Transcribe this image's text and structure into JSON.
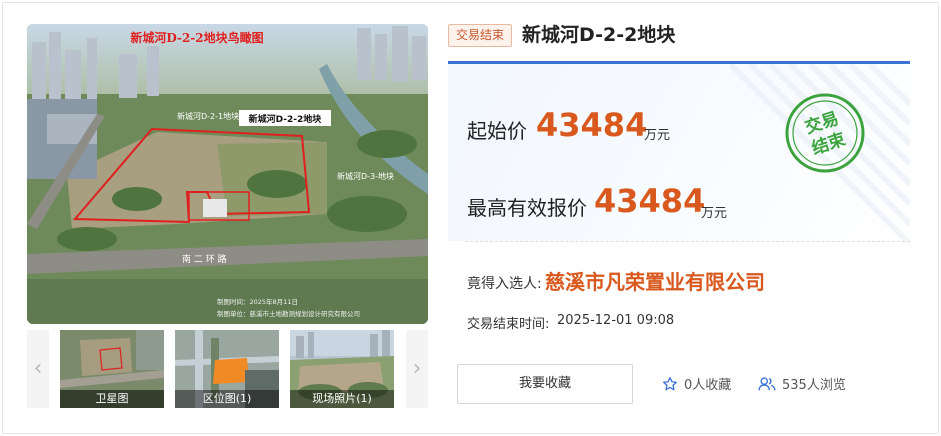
{
  "gallery": {
    "main_photo": {
      "caption_top": "新城河D-2-2地块鸟瞰图",
      "callouts": [
        "新城河D-2-1地块",
        "新城河D-2-2地块",
        "新城河D-3-地块"
      ],
      "road_label": "南 二 环 路",
      "footer_lines": [
        "制图时间：2025年8月11日",
        "制图单位：慈溪市土地勘测规划设计研究有限公司"
      ]
    },
    "prev_arrow": "‹",
    "next_arrow": "›",
    "thumbnails": [
      {
        "label": "卫星图"
      },
      {
        "label": "区位图(1)"
      },
      {
        "label": "现场照片(1)"
      }
    ]
  },
  "lot": {
    "status": "交易结束",
    "title": "新城河D-2-2地块",
    "stamp_text_top": "交易",
    "stamp_text_bottom": "结束",
    "start_price_label": "起始价",
    "start_price_value": "43484",
    "start_price_unit": "万元",
    "best_bid_label": "最高有效报价",
    "best_bid_value": "43484",
    "best_bid_unit": "万元",
    "winner_label": "竟得入选人:",
    "winner_value": "慈溪市凡荣置业有限公司",
    "end_time_label": "交易结束时间:",
    "end_time_value": "2025-12-01 09:08"
  },
  "actions": {
    "favorite_button": "我要收藏",
    "favorites_count": "0人收藏",
    "views_count": "535人浏览"
  },
  "colors": {
    "accent_orange": "#d9581d",
    "accent_blue": "#3b72d6",
    "stamp_green": "#3aa33c"
  }
}
